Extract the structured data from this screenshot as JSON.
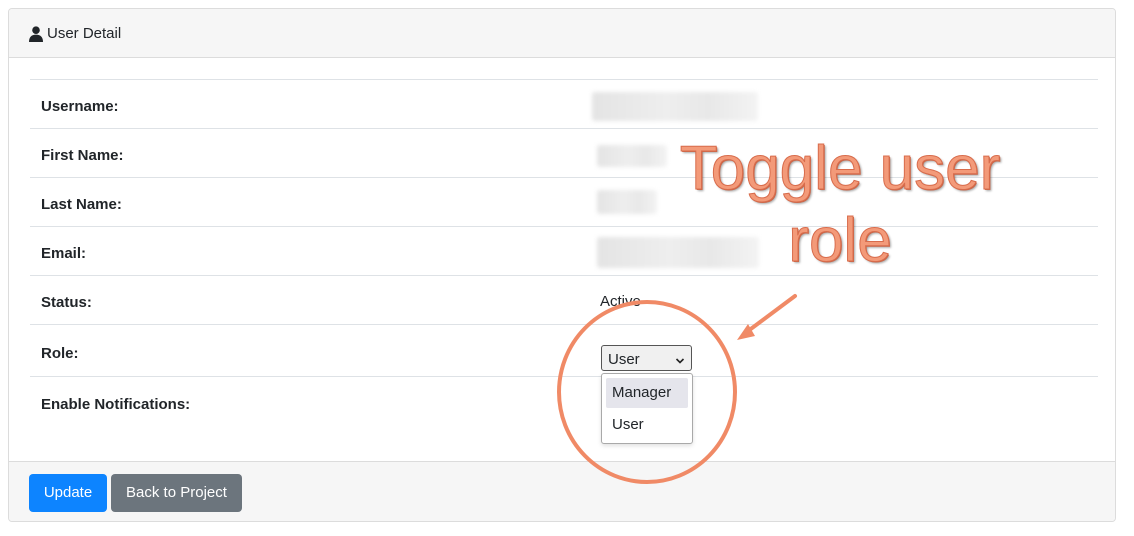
{
  "header": {
    "title": "User Detail",
    "icon": "user-icon"
  },
  "fields": [
    {
      "label": "Username:",
      "value": ""
    },
    {
      "label": "First Name:",
      "value": ""
    },
    {
      "label": "Last Name:",
      "value": ""
    },
    {
      "label": "Email:",
      "value": ""
    },
    {
      "label": "Status:",
      "value": "Active"
    },
    {
      "label": "Role:",
      "value": ""
    },
    {
      "label": "Enable Notifications:",
      "value": ""
    }
  ],
  "role_select": {
    "selected": "User",
    "options": [
      "Manager",
      "User"
    ],
    "highlighted": "Manager"
  },
  "footer": {
    "update_label": "Update",
    "back_label": "Back to Project"
  },
  "annotation": {
    "line1": "Toggle user",
    "line2": "role",
    "color": "#f08a66"
  },
  "colors": {
    "primary": "#0d84ff",
    "secondary": "#6c757d"
  }
}
